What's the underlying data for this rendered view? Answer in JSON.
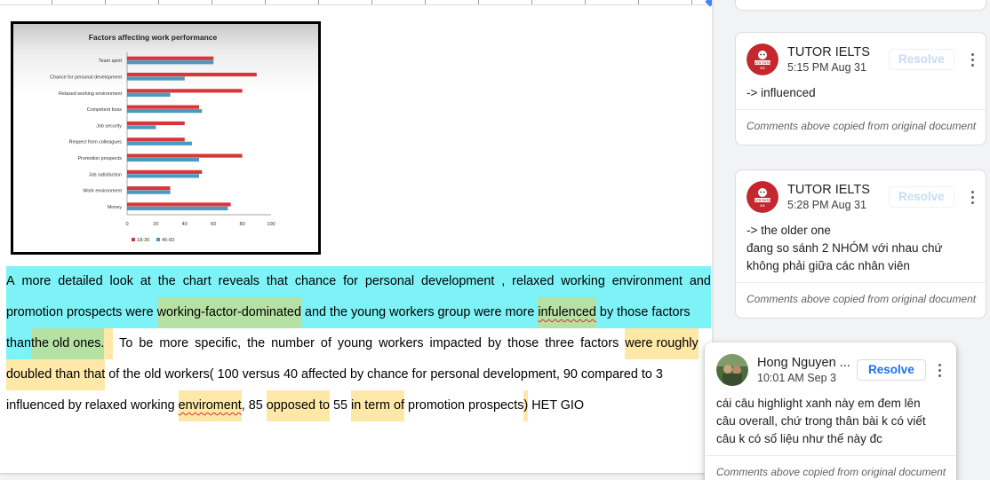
{
  "chart_data": {
    "type": "bar",
    "orientation": "horizontal",
    "title": "Factors affecting work performance",
    "categories": [
      "Team spirit",
      "Chance for personal development",
      "Relaxed working environment",
      "Competent boss",
      "Job security",
      "Respect from colleagues",
      "Promotion prospects",
      "Job satisfaction",
      "Work environment",
      "Money"
    ],
    "series": [
      {
        "name": "18-30",
        "color": "#d6373b",
        "values": [
          60,
          90,
          80,
          50,
          40,
          40,
          80,
          52,
          30,
          72
        ]
      },
      {
        "name": "45-60",
        "color": "#4a9ac0",
        "values": [
          60,
          40,
          30,
          52,
          20,
          45,
          50,
          50,
          30,
          70
        ]
      }
    ],
    "xticks": [
      "0",
      "20",
      "40",
      "60",
      "80",
      "100"
    ],
    "xlim": [
      0,
      100
    ],
    "legend_position": "bottom"
  },
  "document": {
    "line1": [
      "A",
      "more",
      "detailed",
      "look",
      "at",
      "the",
      "chart",
      "reveals",
      "that",
      "chance",
      "for",
      "personal",
      "development",
      ",",
      "relaxed",
      "working",
      "environment",
      "and"
    ],
    "line2": {
      "a": "promotion prospects were ",
      "b": "working-factor-dominated",
      "c": " and the young workers group were more ",
      "d": "infulenced",
      "e": " by those factors"
    },
    "line3": {
      "a": "than ",
      "b": "the old ones.",
      "c": " To be more specific, the number of young workers impacted by those three factors ",
      "d": "were roughly"
    },
    "line4": {
      "a": "doubled than that",
      "b": " of the old workers( 100 versus 40 affected by chance for personal development, 90 compared to 3"
    },
    "line5": {
      "a": "influenced by relaxed working ",
      "b": "enviroment",
      "c": ", 85 ",
      "d": "opposed to",
      "e": " 55 ",
      "f": "in term of",
      "g": " promotion prospects",
      "h": ")",
      "i": " HET GIO"
    }
  },
  "comments": [
    {
      "author": "TUTOR IELTS",
      "time": "5:15 PM Aug 31",
      "resolve_label": "Resolve",
      "lines": [
        "-> influenced"
      ],
      "footer": "Comments above copied from original document",
      "avatar_text": "IELTS TUTOR 9.0"
    },
    {
      "author": "TUTOR IELTS",
      "time": "5:28 PM Aug 31",
      "resolve_label": "Resolve",
      "lines": [
        "-> the older one",
        "đang so sánh 2 NHÓM với nhau chứ",
        "không phải giữa các nhân viên"
      ],
      "footer": "Comments above copied from original document",
      "avatar_text": "IELTS TUTOR 9.0"
    },
    {
      "author": "Hong Nguyen ...",
      "time": "10:01 AM Sep 3",
      "resolve_label": "Resolve",
      "lines": [
        "cái câu highlight xanh này em đem lên",
        "câu overall, chứ trong thân bài k có viết",
        "câu k có số liệu như thế này đc"
      ],
      "footer": "Comments above copied from original document"
    }
  ],
  "colors": {
    "accent": "#1a73e8",
    "highlight_cyan": "#7ef3f7",
    "highlight_green": "#b6e1a4",
    "highlight_yellow": "#fde8a8",
    "tutor_avatar": "#c4272d"
  }
}
